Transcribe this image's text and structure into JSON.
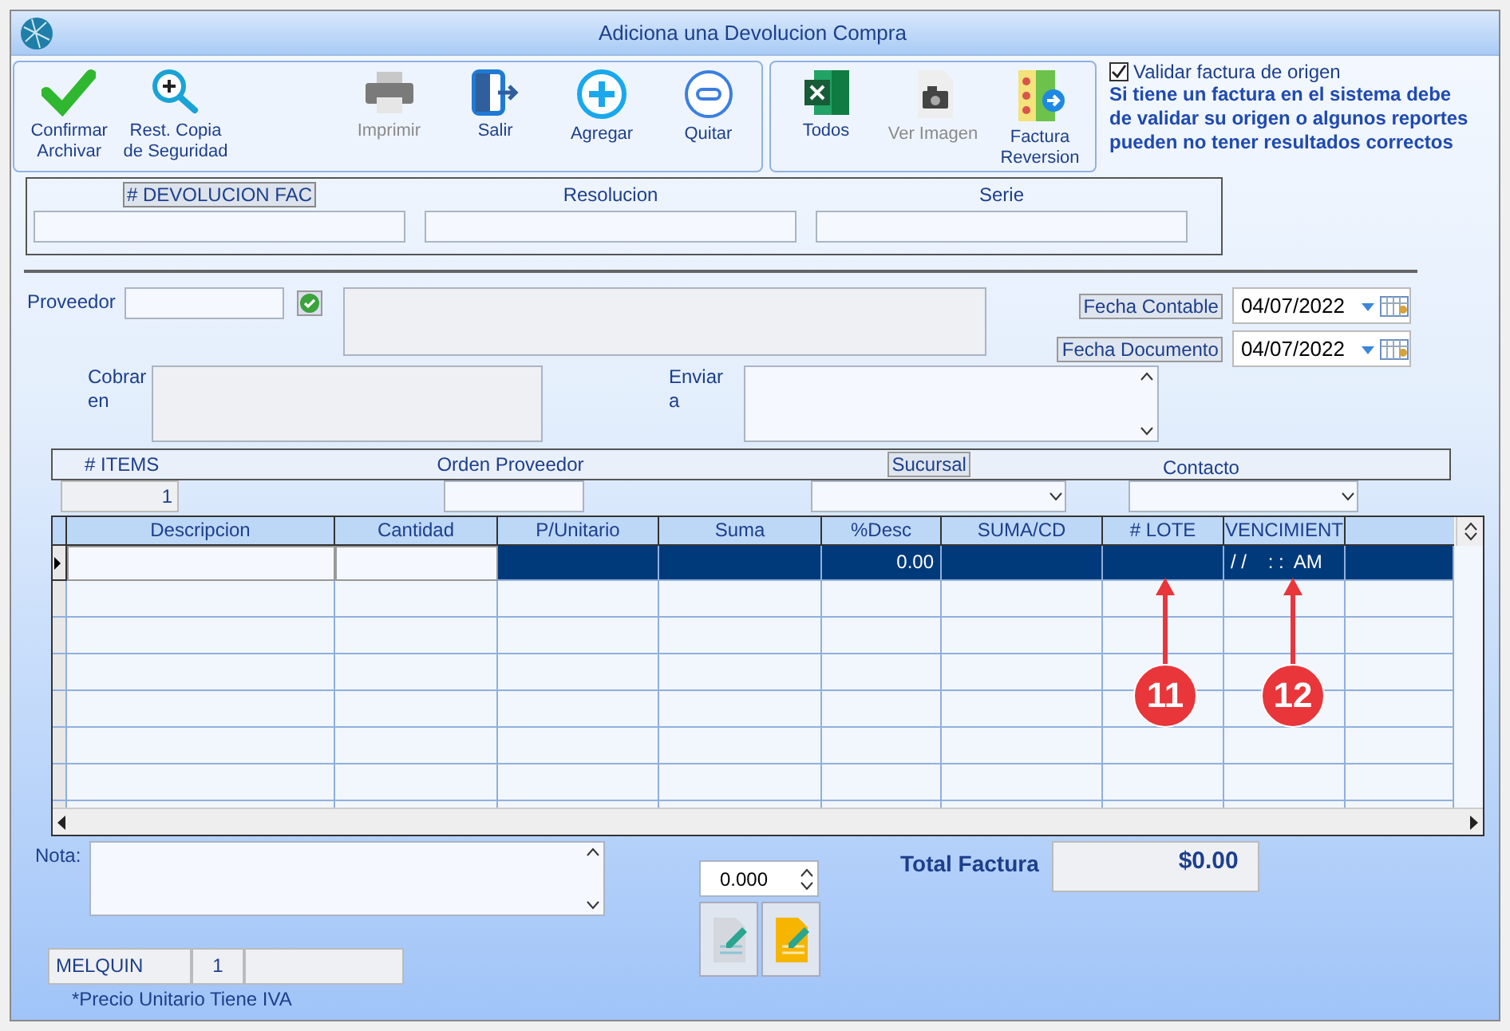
{
  "window": {
    "title": "Adiciona una Devolucion Compra"
  },
  "toolbar": {
    "groups": [
      {
        "buttons": [
          {
            "label": "Confirmar Archivar",
            "disabled": false
          },
          {
            "label": "Rest. Copia de Seguridad",
            "disabled": false
          },
          {
            "label": "Imprimir",
            "disabled": true
          },
          {
            "label": "Salir",
            "disabled": false
          },
          {
            "label": "Agregar",
            "disabled": false
          },
          {
            "label": "Quitar",
            "disabled": false
          }
        ]
      },
      {
        "buttons": [
          {
            "label": "Todos",
            "disabled": false
          },
          {
            "label": "Ver Imagen",
            "disabled": true
          },
          {
            "label": "Factura Reversion",
            "disabled": false
          }
        ]
      }
    ]
  },
  "validation": {
    "checkbox": {
      "label": "Validar factura de origen",
      "checked": true
    },
    "note": "Si tiene un factura en el sistema debe de validar su origen o algunos reportes pueden no tener resultados correctos"
  },
  "document": {
    "fields": [
      {
        "label": "# DEVOLUCION FAC",
        "highlighted": true
      },
      {
        "label": "Resolucion",
        "highlighted": false
      },
      {
        "label": "Serie",
        "highlighted": false
      }
    ]
  },
  "proveedor": {
    "label": "Proveedor"
  },
  "dates": [
    {
      "label": "Fecha Contable",
      "value": "04/07/2022"
    },
    {
      "label": "Fecha Documento",
      "value": "04/07/2022"
    }
  ],
  "cobrar": {
    "label": "Cobrar en"
  },
  "enviar": {
    "label": "Enviar a"
  },
  "items_bar": {
    "items_label": "# ITEMS",
    "orden_label": "Orden Proveedor",
    "sucursal_label": "Sucursal",
    "contacto_label": "Contacto",
    "items_value": "1"
  },
  "grid": {
    "columns": [
      "Descripcion",
      "Cantidad",
      "P/Unitario",
      "Suma",
      "%Desc",
      "SUMA/CD",
      "# LOTE",
      "VENCIMIENT"
    ],
    "rows": [
      {
        "selected": true,
        "cells": [
          "",
          "",
          "",
          "",
          "0.00",
          "",
          "",
          "/ /    : :  AM"
        ]
      }
    ]
  },
  "annotations": [
    {
      "label": "11"
    },
    {
      "label": "12"
    }
  ],
  "nota": {
    "label": "Nota:"
  },
  "spinner": {
    "value": "0.000"
  },
  "total": {
    "label": "Total Factura",
    "value": "$0.00"
  },
  "status": {
    "user": "MELQUIN",
    "number": "1"
  },
  "footnote": "*Precio Unitario Tiene IVA"
}
